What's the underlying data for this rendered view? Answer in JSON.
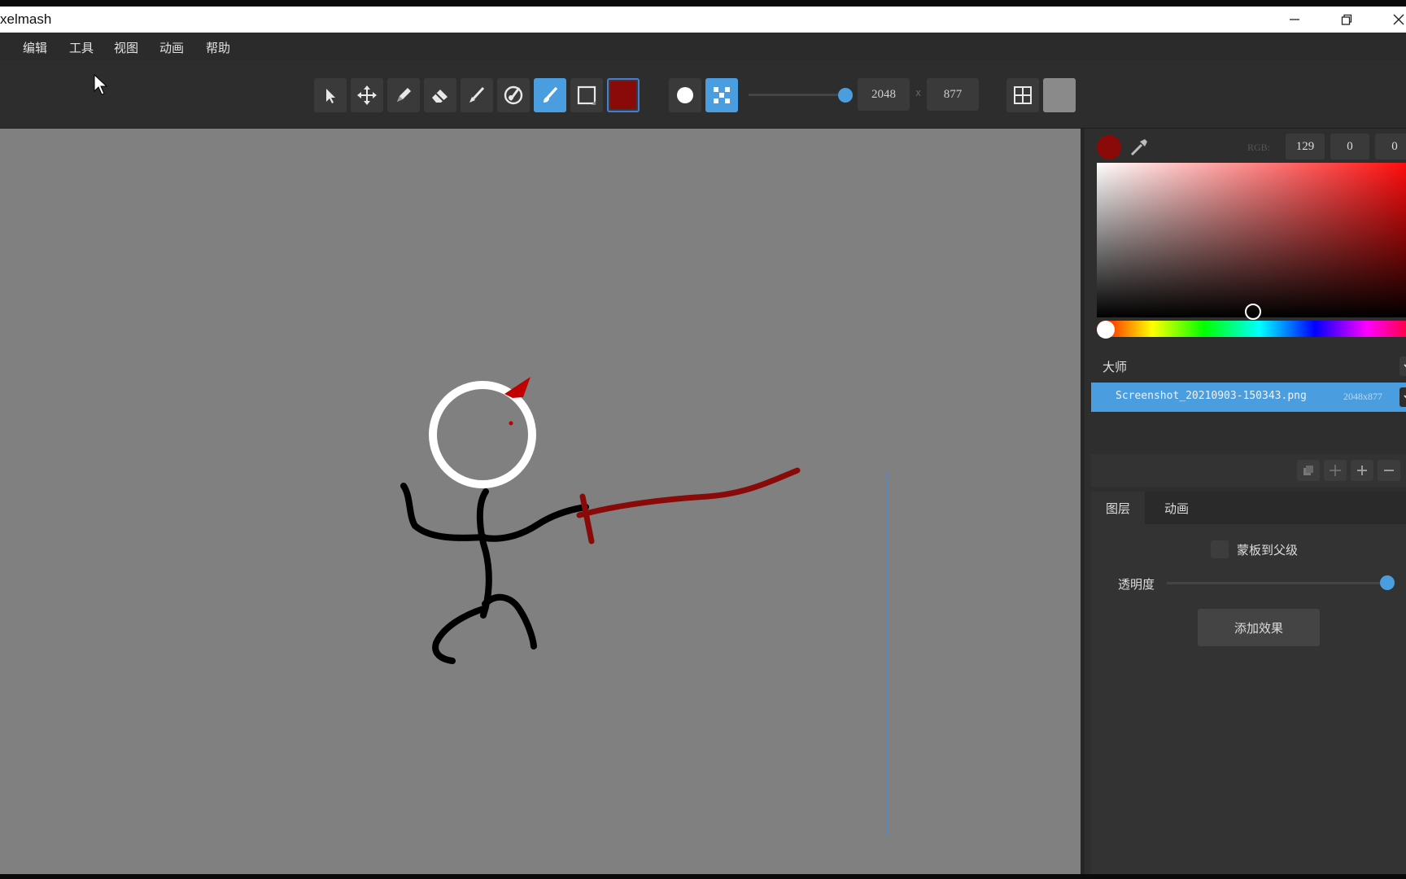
{
  "window": {
    "title": "xelmash",
    "controls": [
      "minimize",
      "restore",
      "close"
    ]
  },
  "menu": {
    "items": [
      "编辑",
      "工具",
      "视图",
      "动画",
      "帮助"
    ]
  },
  "toolbar": {
    "tools": [
      "select-icon",
      "move-icon",
      "pencil-icon",
      "eraser-icon",
      "brush-icon",
      "fill-icon",
      "paint-brush-icon",
      "rectangle-icon"
    ],
    "active_tool": "paint-brush-icon",
    "current_color": "#8a0a0a",
    "brush_shape_options": [
      "round-brush-icon",
      "pattern-brush-icon"
    ],
    "width": "2048",
    "height": "877",
    "extra_buttons": [
      "grid-icon",
      "background-swatch"
    ]
  },
  "color_picker": {
    "rgb_label": "RGB:",
    "r": "129",
    "g": "0",
    "b": "0",
    "color": "#8a0a0a"
  },
  "layers": {
    "section_label": "大师",
    "items": [
      {
        "name": "Screenshot_20210903-150343.png",
        "dims": "2048x877",
        "selected": true
      }
    ]
  },
  "properties": {
    "tabs": [
      "图层",
      "动画"
    ],
    "active_tab": "图层",
    "mask_to_parent_label": "蒙板到父级",
    "opacity_label": "透明度",
    "opacity_value": 1.0,
    "add_effect_label": "添加效果"
  }
}
